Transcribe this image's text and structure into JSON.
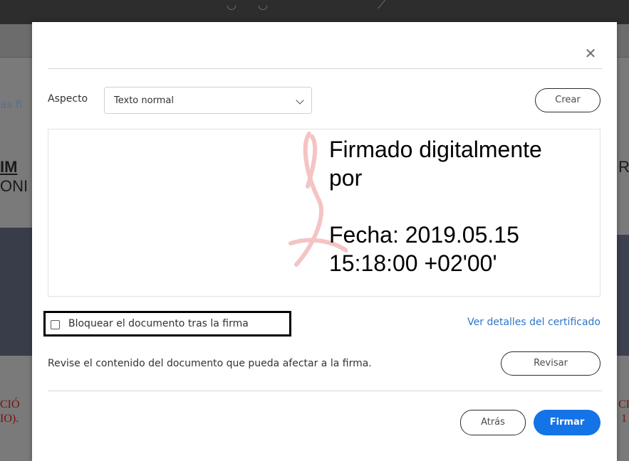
{
  "background": {
    "side_text_left_top": "as fi",
    "side_text_left_bold": "IM",
    "side_text_left_big": "ONI",
    "side_text_right_big": "R",
    "side_text_left_red_1": "CIÓ",
    "side_text_left_red_2": "IO).",
    "side_text_right_red_1": "CIA",
    "side_text_right_red_2": "1"
  },
  "dialog": {
    "close_icon": "close-icon",
    "aspect": {
      "label": "Aspecto",
      "selected": "Texto normal",
      "chevron_icon": "chevron-down-icon"
    },
    "create_button": "Crear",
    "signature_preview": {
      "line1": "Firmado digitalmente",
      "line2": "por",
      "line3": "Fecha: 2019.05.15",
      "line4": "15:18:00 +02'00'"
    },
    "lock_checkbox": {
      "label": "Bloquear el documento tras la firma",
      "checked": false
    },
    "certificate_link": "Ver detalles del certificado",
    "review_text": "Revise el contenido del documento que pueda afectar a la firma.",
    "review_button": "Revisar",
    "back_button": "Atrás",
    "sign_button": "Firmar"
  },
  "colors": {
    "accent": "#1473e6",
    "link": "#2d76c8",
    "highlight_border": "#000000"
  }
}
